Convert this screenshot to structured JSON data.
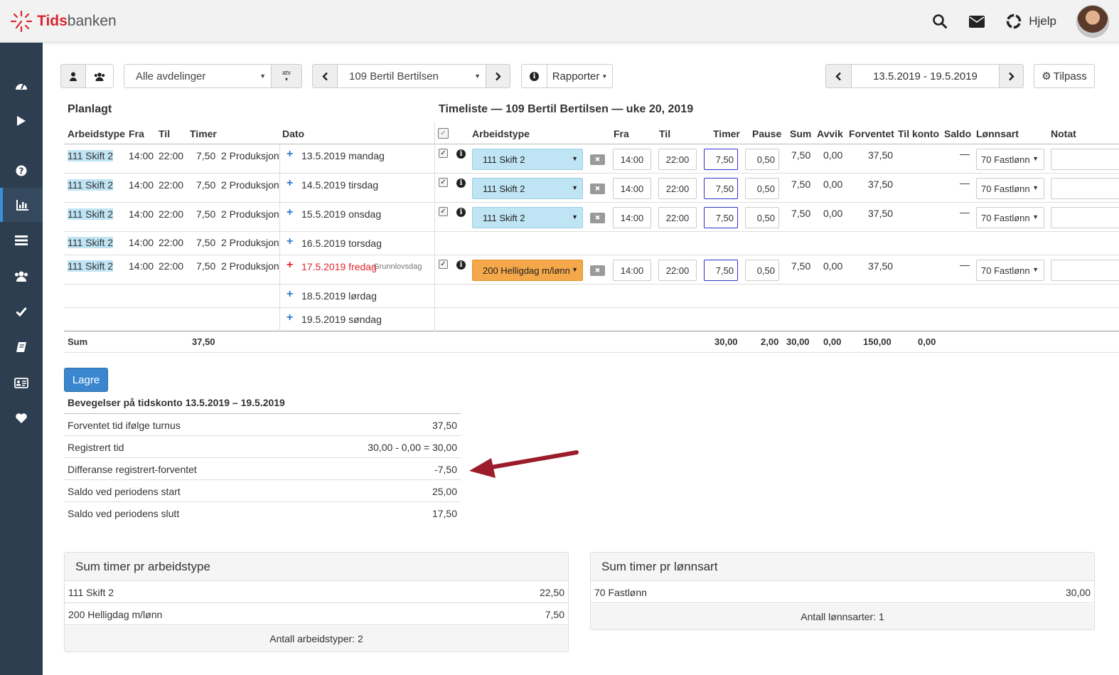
{
  "app": {
    "brand_part1": "Tids",
    "brand_part2": "banken",
    "help_label": "Hjelp"
  },
  "toolbar": {
    "department": "Alle avdelinger",
    "department_suffix": "atv",
    "employee": "109 Bertil Bertilsen",
    "reports_label": "Rapporter",
    "date_range": "13.5.2019 - 19.5.2019",
    "customize_label": "Tilpass"
  },
  "planned": {
    "title": "Planlagt",
    "headers": {
      "worktype": "Arbeidstype",
      "from": "Fra",
      "to": "Til",
      "hours": "Timer",
      "date": "Dato"
    },
    "rows": [
      {
        "worktype": "111 Skift 2",
        "from": "14:00",
        "to": "22:00",
        "hours": "7,50",
        "dept": "2 Produksjon",
        "date": "13.5.2019 mandag",
        "note": ""
      },
      {
        "worktype": "111 Skift 2",
        "from": "14:00",
        "to": "22:00",
        "hours": "7,50",
        "dept": "2 Produksjon",
        "date": "14.5.2019 tirsdag",
        "note": ""
      },
      {
        "worktype": "111 Skift 2",
        "from": "14:00",
        "to": "22:00",
        "hours": "7,50",
        "dept": "2 Produksjon",
        "date": "15.5.2019 onsdag",
        "note": ""
      },
      {
        "worktype": "111 Skift 2",
        "from": "14:00",
        "to": "22:00",
        "hours": "7,50",
        "dept": "2 Produksjon",
        "date": "16.5.2019 torsdag",
        "note": ""
      },
      {
        "worktype": "111 Skift 2",
        "from": "14:00",
        "to": "22:00",
        "hours": "7,50",
        "dept": "2 Produksjon",
        "date": "17.5.2019 fredag",
        "note": "Grunnlovsdag"
      },
      {
        "worktype": "",
        "from": "",
        "to": "",
        "hours": "",
        "dept": "",
        "date": "18.5.2019 lørdag",
        "note": ""
      },
      {
        "worktype": "",
        "from": "",
        "to": "",
        "hours": "",
        "dept": "",
        "date": "19.5.2019 søndag",
        "note": ""
      }
    ],
    "sum_label": "Sum",
    "sum_hours": "37,50"
  },
  "timesheet": {
    "title": "Timeliste — 109 Bertil Bertilsen — uke 20, 2019",
    "headers": {
      "worktype": "Arbeidstype",
      "from": "Fra",
      "to": "Til",
      "hours": "Timer",
      "pause": "Pause",
      "sum": "Sum",
      "deviation": "Avvik",
      "expected": "Forventet",
      "to_account": "Til konto",
      "balance": "Saldo",
      "wage_type": "Lønnsart",
      "note": "Notat"
    },
    "rows": [
      {
        "worktype": "111 Skift 2",
        "from": "14:00",
        "to": "22:00",
        "hours": "7,50",
        "pause": "0,50",
        "sum": "7,50",
        "deviation": "0,00",
        "expected": "37,50",
        "balance": "—",
        "wage_type": "70 Fastlønn"
      },
      {
        "worktype": "111 Skift 2",
        "from": "14:00",
        "to": "22:00",
        "hours": "7,50",
        "pause": "0,50",
        "sum": "7,50",
        "deviation": "0,00",
        "expected": "37,50",
        "balance": "—",
        "wage_type": "70 Fastlønn"
      },
      {
        "worktype": "111 Skift 2",
        "from": "14:00",
        "to": "22:00",
        "hours": "7,50",
        "pause": "0,50",
        "sum": "7,50",
        "deviation": "0,00",
        "expected": "37,50",
        "balance": "—",
        "wage_type": "70 Fastlønn"
      },
      {
        "worktype": "200 Helligdag m/lønn",
        "from": "14:00",
        "to": "22:00",
        "hours": "7,50",
        "pause": "0,50",
        "sum": "7,50",
        "deviation": "0,00",
        "expected": "37,50",
        "balance": "—",
        "wage_type": "70 Fastlønn"
      }
    ],
    "sums": {
      "hours": "30,00",
      "pause": "2,00",
      "sum": "30,00",
      "deviation": "0,00",
      "expected": "150,00",
      "to_account": "0,00"
    }
  },
  "save_label": "Lagre",
  "movements": {
    "title": "Bevegelser på tidskonto 13.5.2019 – 19.5.2019",
    "rows": [
      {
        "label": "Forventet tid ifølge turnus",
        "value": "37,50"
      },
      {
        "label": "Registrert tid",
        "value": "30,00 - 0,00 = 30,00"
      },
      {
        "label": "Differanse registrert-forventet",
        "value": "-7,50"
      },
      {
        "label": "Saldo ved periodens start",
        "value": "25,00"
      },
      {
        "label": "Saldo ved periodens slutt",
        "value": "17,50"
      }
    ]
  },
  "sum_by_worktype": {
    "title": "Sum timer pr arbeidstype",
    "rows": [
      {
        "label": "111 Skift 2",
        "value": "22,50"
      },
      {
        "label": "200 Helligdag m/lønn",
        "value": "7,50"
      }
    ],
    "footer": "Antall arbeidstyper: 2"
  },
  "sum_by_wagetype": {
    "title": "Sum timer pr lønnsart",
    "rows": [
      {
        "label": "70 Fastlønn",
        "value": "30,00"
      }
    ],
    "footer": "Antall lønnsarter: 1"
  },
  "colors": {
    "sidebar": "#2d3e50",
    "accent": "#3a87d0",
    "holiday_red": "#e0262e",
    "worktype_blue": "#bfe4f4",
    "holiday_orange": "#f5a84a",
    "arrow": "#9b1c2a"
  }
}
